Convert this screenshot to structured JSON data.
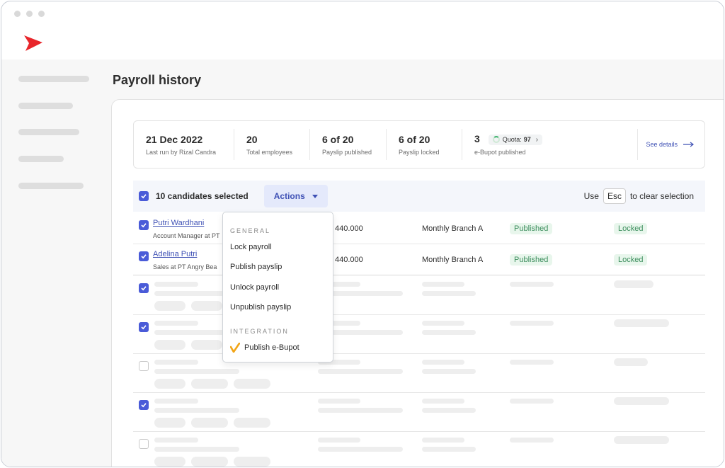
{
  "page": {
    "title": "Payroll history"
  },
  "stats": [
    {
      "value": "21 Dec 2022",
      "label": "Last run by Rizal Candra"
    },
    {
      "value": "20",
      "label": "Total employees"
    },
    {
      "value": "6 of 20",
      "label": "Payslip published"
    },
    {
      "value": "6 of 20",
      "label": "Payslip locked"
    },
    {
      "value": "3",
      "label": "e-Bupot published",
      "quota_label": "Quota:",
      "quota_value": "97"
    }
  ],
  "see_details": "See details",
  "selection": {
    "text": "10 candidates selected",
    "actions_label": "Actions",
    "hint_prefix": "Use",
    "hint_key": "Esc",
    "hint_suffix": "to clear selection"
  },
  "rows": [
    {
      "name": "Putri Wardhani",
      "role": "Account Manager at PT",
      "amount": "440.000",
      "branch": "Monthly Branch A",
      "payslip_status": "Published",
      "lock_status": "Locked"
    },
    {
      "name": "Adelina Putri",
      "role": "Sales at PT Angry Bea",
      "amount": "440.000",
      "branch": "Monthly Branch A",
      "payslip_status": "Published",
      "lock_status": "Locked"
    }
  ],
  "dropdown": {
    "general_heading": "GENERAL",
    "items": [
      "Lock payroll",
      "Publish payslip",
      "Unlock payroll",
      "Unpublish payslip"
    ],
    "integration_heading": "INTEGRATION",
    "integration_item": "Publish e-Bupot"
  },
  "colors": {
    "accent": "#4a5bd8",
    "brand": "#e8262b",
    "success": "#3b8d5c"
  },
  "icons": [
    "logo-icon",
    "checkbox-checked-icon",
    "checkbox-empty-icon",
    "caret-down-icon",
    "chevron-right-icon",
    "arrow-right-icon",
    "ebupot-check-icon"
  ]
}
